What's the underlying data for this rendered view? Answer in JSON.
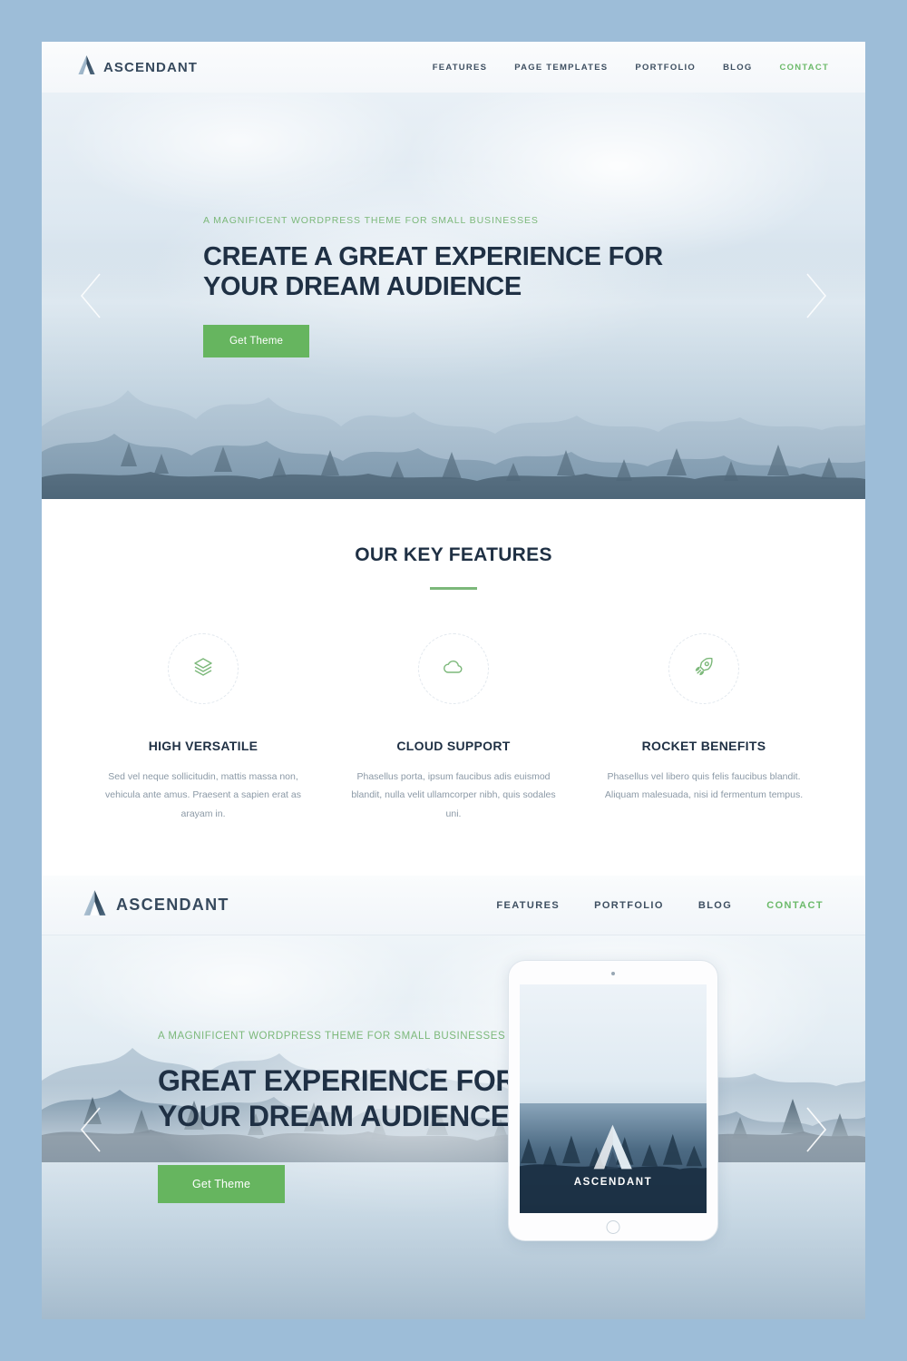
{
  "theme": {
    "accent_green": "#66b55f",
    "kicker_green": "#7cb87a",
    "dark_navy": "#1f3044",
    "page_bg": "#9dbdd8"
  },
  "header_primary": {
    "logo_icon": "ascendant-a-logo-icon",
    "brand": "ASCENDANT",
    "nav": [
      {
        "label": "FEATURES",
        "active": false
      },
      {
        "label": "PAGE TEMPLATES",
        "active": false
      },
      {
        "label": "PORTFOLIO",
        "active": false
      },
      {
        "label": "BLOG",
        "active": false
      },
      {
        "label": "CONTACT",
        "active": true
      }
    ]
  },
  "hero_primary": {
    "kicker": "A MAGNIFICENT WORDPRESS THEME FOR SMALL BUSINESSES",
    "title_line1": "CREATE A GREAT EXPERIENCE FOR",
    "title_line2": "YOUR DREAM AUDIENCE",
    "cta_label": "Get Theme",
    "prev_icon": "chevron-left-icon",
    "next_icon": "chevron-right-icon"
  },
  "features": {
    "heading": "OUR KEY FEATURES",
    "items": [
      {
        "icon": "layers-icon",
        "title": "HIGH VERSATILE",
        "body": "Sed vel neque sollicitudin, mattis massa non, vehicula ante amus. Praesent a sapien erat as arayam in."
      },
      {
        "icon": "cloud-icon",
        "title": "CLOUD SUPPORT",
        "body": "Phasellus porta, ipsum faucibus adis euismod blandit, nulla velit ullamcorper nibh, quis sodales uni."
      },
      {
        "icon": "rocket-icon",
        "title": "ROCKET BENEFITS",
        "body": "Phasellus vel libero quis felis faucibus blandit. Aliquam malesuada, nisi id fermentum tempus."
      }
    ]
  },
  "header_secondary": {
    "logo_icon": "ascendant-a-logo-icon",
    "brand": "ASCENDANT",
    "nav": [
      {
        "label": "FEATURES",
        "active": false
      },
      {
        "label": "PORTFOLIO",
        "active": false
      },
      {
        "label": "BLOG",
        "active": false
      },
      {
        "label": "CONTACT",
        "active": true
      }
    ]
  },
  "hero_secondary": {
    "kicker": "A MAGNIFICENT WORDPRESS THEME FOR SMALL BUSINESSES",
    "title_line1": "GREAT EXPERIENCE FOR",
    "title_line2": "YOUR DREAM AUDIENCE",
    "cta_label": "Get Theme",
    "prev_icon": "chevron-left-icon",
    "next_icon": "chevron-right-icon"
  },
  "tablet_mockup": {
    "device": "tablet-device-frame",
    "screen_brand": "ASCENDANT",
    "screen_logo_icon": "ascendant-a-logo-icon"
  }
}
